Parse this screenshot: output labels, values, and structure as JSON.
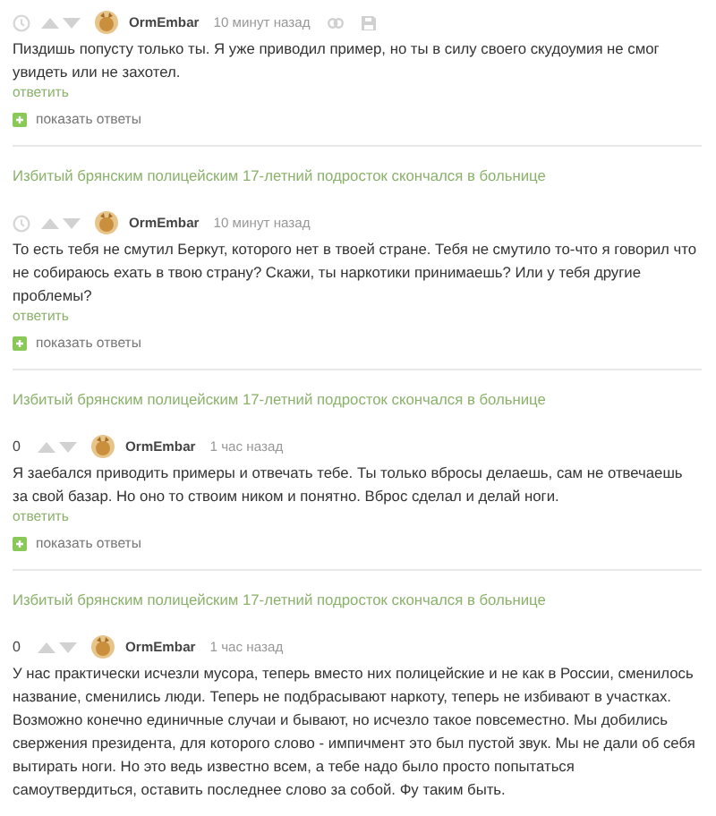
{
  "feed": [
    {
      "kind": "comment",
      "author": "OrmEmbar",
      "time": "10 минут назад",
      "show_tools": true,
      "text": "Пиздишь попусту только ты. Я уже приводил пример, но ты в силу своего скудоумия не смог увидеть или не захотел.",
      "reply": "ответить",
      "show_replies": "показать ответы"
    },
    {
      "kind": "story",
      "title": "Избитый брянским полицейским 17-летний подросток скончался в больнице"
    },
    {
      "kind": "comment",
      "author": "OrmEmbar",
      "time": "10 минут назад",
      "show_tools": false,
      "text": "То есть тебя не смутил Беркут, которого нет в твоей стране. Тебя не смутило то-что я говорил что не собираюсь ехать в твою страну? Скажи, ты наркотики принимаешь? Или у тебя другие проблемы?",
      "reply": "ответить",
      "show_replies": "показать ответы"
    },
    {
      "kind": "story",
      "title": "Избитый брянским полицейским 17-летний подросток скончался в больнице"
    },
    {
      "kind": "comment",
      "rating": "0",
      "author": "OrmEmbar",
      "time": "1 час назад",
      "show_tools": false,
      "text": "Я заебался приводить примеры и отвечать тебе. Ты только вбросы делаешь, сам не отвечаешь за свой базар. Но оно то ствоим ником и понятно. Вброс сделал и делай ноги.",
      "reply": "ответить",
      "show_replies": "показать ответы"
    },
    {
      "kind": "story",
      "title": "Избитый брянским полицейским 17-летний подросток скончался в больнице"
    },
    {
      "kind": "comment",
      "rating": "0",
      "author": "OrmEmbar",
      "time": "1 час назад",
      "show_tools": false,
      "text": "У нас практически исчезли мусора, теперь вместо них полицейские и не как в России, сменилось название, сменились люди. Теперь не подбрасывают наркоту, теперь не избивают в участках. Возможно конечно единичные случаи и бывают, но исчезло такое повсеместно. Мы добились свержения президента, для которого слово - импичмент это был пустой звук. Мы не дали об себя вытирать ноги. Но это ведь известно всем, а тебе надо было просто попытаться самоутвердиться, оставить последнее слово за собой. Фу таким быть."
    }
  ]
}
